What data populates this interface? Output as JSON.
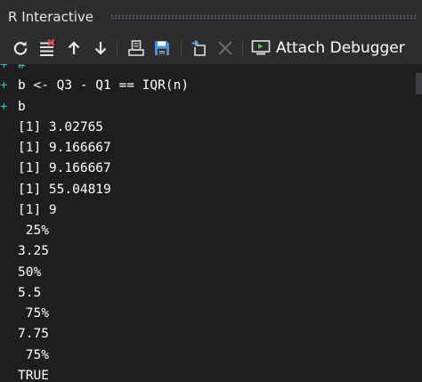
{
  "window": {
    "title": "R Interactive"
  },
  "toolbar": {
    "icons": [
      "reset-icon",
      "clear-icon",
      "history-up-icon",
      "history-down-icon",
      "load-workspace-icon",
      "save-workspace-icon",
      "interrupt-icon",
      "terminate-icon",
      "attach-debugger-icon"
    ],
    "attach_label": "Attach Debugger"
  },
  "colors": {
    "background": "#1e1e1e",
    "chrome": "#2d2d30",
    "prompt": "#3bb9a8",
    "text": "#ffffff",
    "debugger_green": "#4ec94e"
  },
  "console": {
    "lines": [
      {
        "prompt": "+",
        "text": "#",
        "kind": "muted"
      },
      {
        "prompt": "+",
        "text": "b <- Q3 - Q1 == IQR(n)",
        "kind": "cmd"
      },
      {
        "prompt": "+",
        "text": "b",
        "kind": "cmd"
      },
      {
        "prompt": "",
        "text": "[1] 3.02765",
        "kind": "out"
      },
      {
        "prompt": "",
        "text": "[1] 9.166667",
        "kind": "out"
      },
      {
        "prompt": "",
        "text": "[1] 9.166667",
        "kind": "out"
      },
      {
        "prompt": "",
        "text": "[1] 55.04819",
        "kind": "out"
      },
      {
        "prompt": "",
        "text": "[1] 9",
        "kind": "out"
      },
      {
        "prompt": "",
        "text": " 25%",
        "kind": "out"
      },
      {
        "prompt": "",
        "text": "3.25",
        "kind": "out"
      },
      {
        "prompt": "",
        "text": "50%",
        "kind": "out"
      },
      {
        "prompt": "",
        "text": "5.5",
        "kind": "out"
      },
      {
        "prompt": "",
        "text": " 75%",
        "kind": "out"
      },
      {
        "prompt": "",
        "text": "7.75",
        "kind": "out"
      },
      {
        "prompt": "",
        "text": " 75%",
        "kind": "out"
      },
      {
        "prompt": "",
        "text": "TRUE",
        "kind": "out"
      }
    ]
  }
}
